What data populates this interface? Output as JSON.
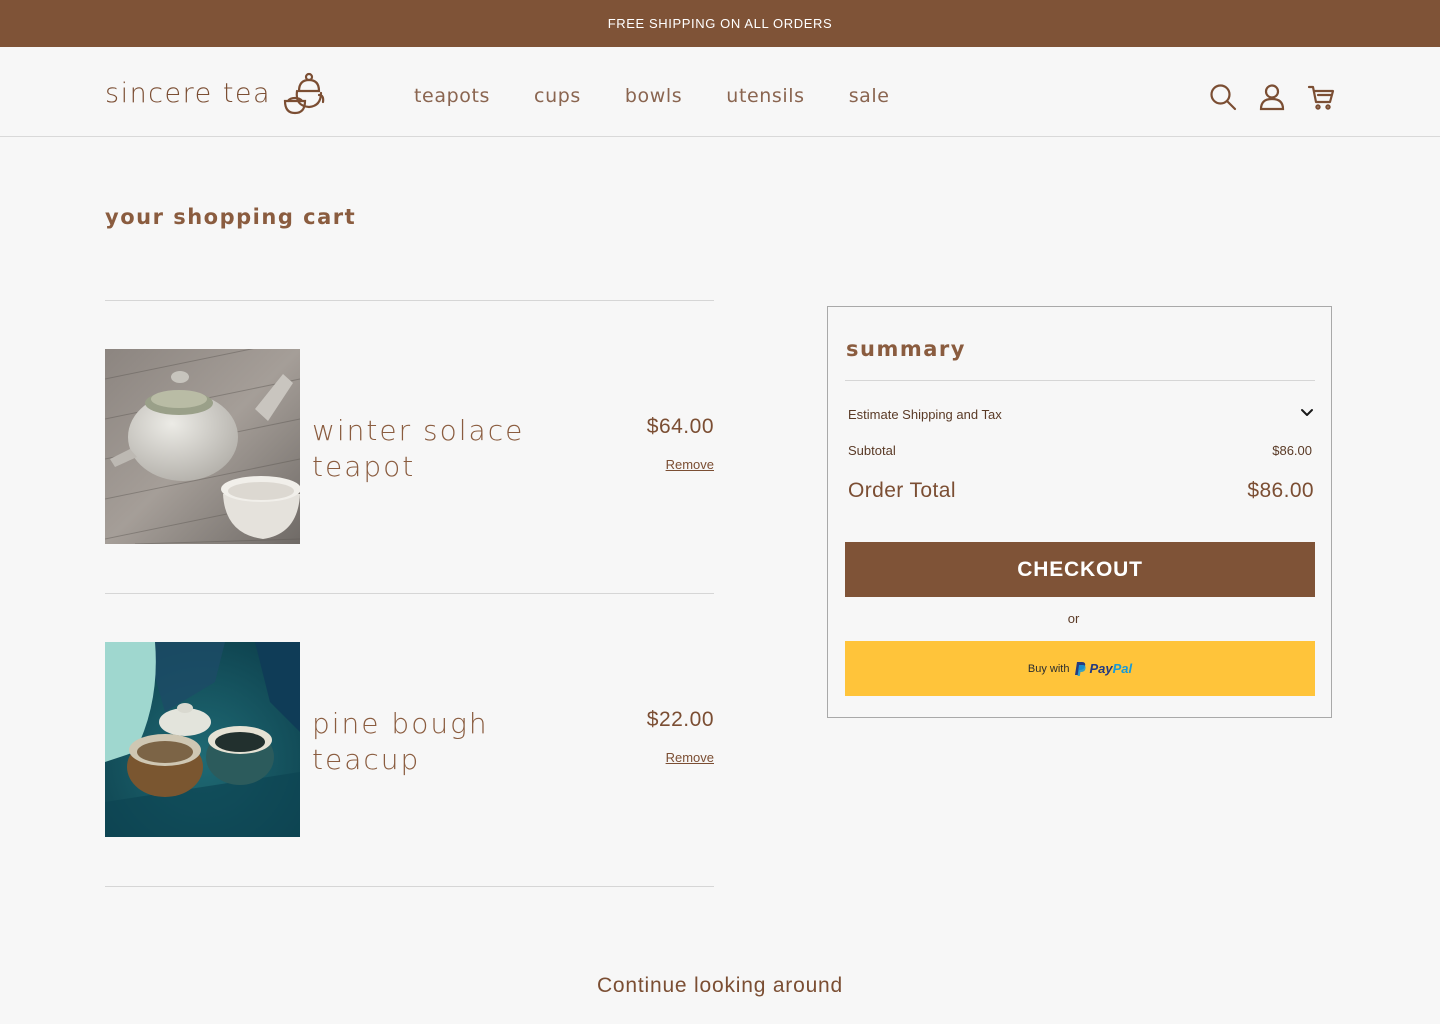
{
  "announcement": "FREE SHIPPING ON ALL ORDERS",
  "brand": {
    "name": "sincere tea"
  },
  "nav": [
    {
      "label": "teapots"
    },
    {
      "label": "cups"
    },
    {
      "label": "bowls"
    },
    {
      "label": "utensils"
    },
    {
      "label": "sale"
    }
  ],
  "header_icons": [
    "search-icon",
    "account-icon",
    "cart-icon"
  ],
  "page_title": "your shopping cart",
  "cart": {
    "items": [
      {
        "name": "winter solace teapot",
        "price": "$64.00",
        "remove_label": "Remove"
      },
      {
        "name": "pine bough teacup",
        "price": "$22.00",
        "remove_label": "Remove"
      }
    ]
  },
  "summary": {
    "title": "summary",
    "shipping_label": "Estimate Shipping and Tax",
    "subtotal_label": "Subtotal",
    "subtotal_value": "$86.00",
    "total_label": "Order Total",
    "total_value": "$86.00",
    "checkout_label": "CHECKOUT",
    "or_label": "or",
    "paypal_prefix": "Buy with",
    "paypal_brand_pay": "Pay",
    "paypal_brand_pal": "Pal"
  },
  "continue_label": "Continue looking around",
  "colors": {
    "brand_brown": "#7f5337",
    "text_brown": "#7b4e33",
    "paypal_yellow": "#ffc43a",
    "background": "#f7f7f7"
  }
}
